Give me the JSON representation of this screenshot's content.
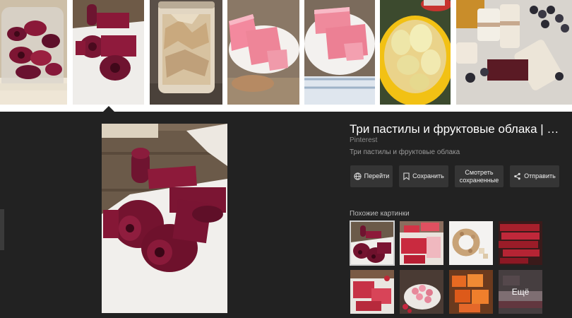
{
  "preview": {
    "title": "Три пастилы и фруктовые облака | …",
    "source": "Pinterest",
    "description": "Три пастилы и фруктовые облака"
  },
  "actions": [
    {
      "label": "Перейти",
      "icon": "globe-icon"
    },
    {
      "label": "Сохранить",
      "icon": "bookmark-icon"
    },
    {
      "label": "Смотреть сохраненные",
      "icon": ""
    },
    {
      "label": "Отправить",
      "icon": "share-icon"
    }
  ],
  "similar": {
    "label": "Похожие картинки",
    "more_label": "Ещё"
  },
  "colors": {
    "panel_bg": "#222222",
    "button_bg": "#353535",
    "beet_red": "#7a1630",
    "pink_pastila": "#ef8a9c"
  }
}
